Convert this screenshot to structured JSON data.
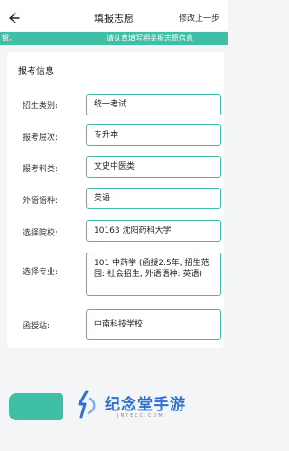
{
  "header": {
    "title": "填报志愿",
    "right_action": "修改上一步"
  },
  "notice": {
    "left_fragment": "钮。",
    "right_text": "请认真填写相关报志愿信息"
  },
  "section": {
    "title": "报考信息"
  },
  "fields": [
    {
      "label": "招生类别:",
      "value": "统一考试"
    },
    {
      "label": "报考层次:",
      "value": "专升本"
    },
    {
      "label": "报考科类:",
      "value": "文史中医类"
    },
    {
      "label": "外语语种:",
      "value": "英语"
    },
    {
      "label": "选择院校:",
      "value": "10163 沈阳药科大学"
    },
    {
      "label": "选择专业:",
      "value": "101 中药学 (函授2.5年, 招生范围: 社会招生, 外语语种: 英语)"
    },
    {
      "label": "函授站:",
      "value": "中南科技学校"
    }
  ],
  "watermark": {
    "brand": "纪念堂手游",
    "site": "JNTECC.COM"
  },
  "colors": {
    "accent": "#3fbfa6",
    "watermark": "#2e6fd6"
  }
}
